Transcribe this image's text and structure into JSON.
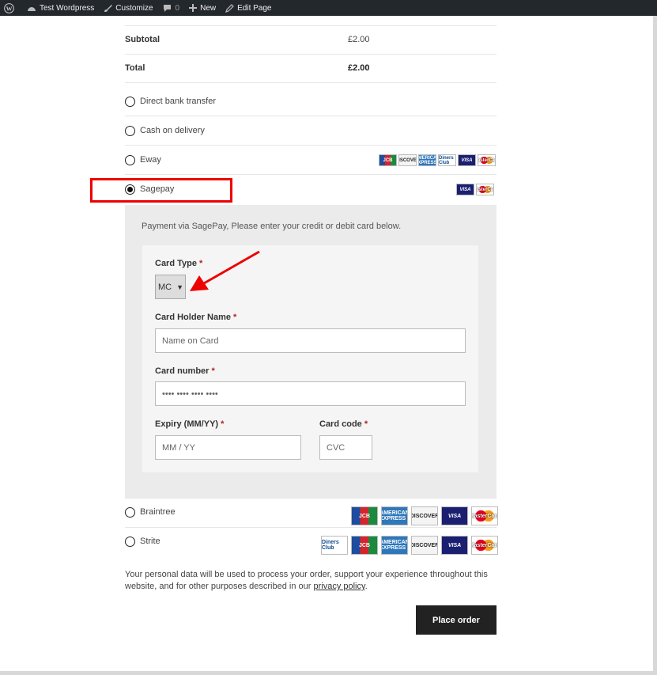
{
  "admin_bar": {
    "site_name": "Test Wordpress",
    "customize": "Customize",
    "comments_count": "0",
    "new": "New",
    "edit_page": "Edit Page"
  },
  "totals": {
    "subtotal_label": "Subtotal",
    "subtotal_value": "£2.00",
    "total_label": "Total",
    "total_value": "£2.00"
  },
  "payment_methods": [
    {
      "label": "Direct bank transfer",
      "selected": false
    },
    {
      "label": "Cash on delivery",
      "selected": false
    },
    {
      "label": "Eway",
      "selected": false,
      "cards": [
        "JCB",
        "DISCOVER",
        "AMERICAN EXPRESS",
        "Diners Club",
        "VISA",
        "MasterCard"
      ]
    },
    {
      "label": "Sagepay",
      "selected": true,
      "cards": [
        "VISA",
        "MasterCard"
      ]
    },
    {
      "label": "Braintree",
      "selected": false,
      "cards": [
        "JCB",
        "AMERICAN EXPRESS",
        "DISCOVER",
        "VISA",
        "MasterCard"
      ]
    },
    {
      "label": "Strite",
      "selected": false,
      "cards": [
        "Diners Club",
        "JCB",
        "AMERICAN EXPRESS",
        "DISCOVER",
        "VISA",
        "MasterCard"
      ]
    }
  ],
  "sagepay_form": {
    "description": "Payment via SagePay, Please enter your credit or debit card below.",
    "card_type_label": "Card Type",
    "card_type_value": "MC",
    "holder_label": "Card Holder Name",
    "holder_placeholder": "Name on Card",
    "number_label": "Card number",
    "number_placeholder": "•••• •••• •••• ••••",
    "expiry_label": "Expiry (MM/YY)",
    "expiry_placeholder": "MM / YY",
    "code_label": "Card code",
    "code_placeholder": "CVC",
    "required_mark": "*"
  },
  "privacy": {
    "text": "Your personal data will be used to process your order, support your experience throughout this website, and for other purposes described in our ",
    "link": "privacy policy",
    "end": "."
  },
  "place_order": "Place order",
  "colors": {
    "highlight": "#e00000",
    "button": "#222222"
  }
}
